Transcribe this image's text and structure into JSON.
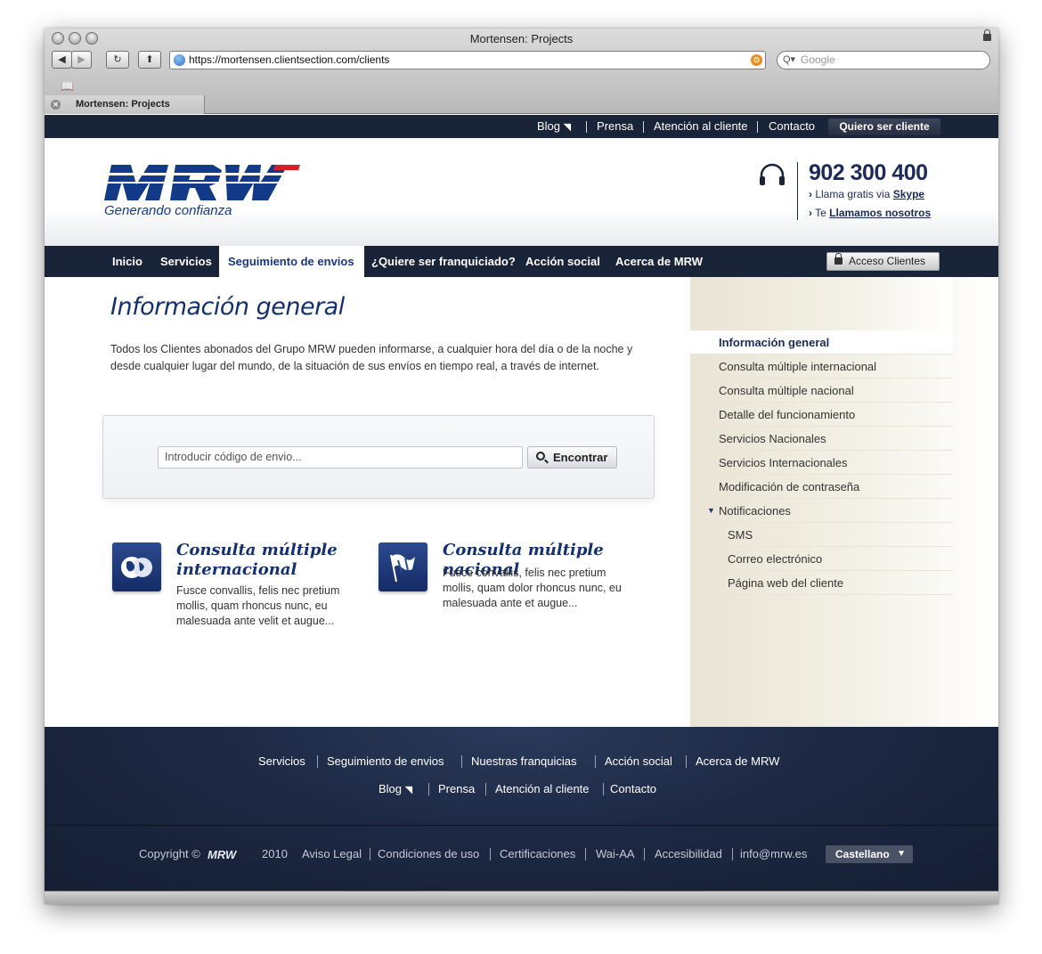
{
  "browser": {
    "window_title": "Mortensen: Projects",
    "url": "https://mortensen.clientsection.com/clients",
    "search_placeholder": "Google",
    "tab_label": "Mortensen: Projects"
  },
  "topbar": {
    "links": [
      "Blog",
      "Prensa",
      "Atención al cliente",
      "Contacto"
    ],
    "cta": "Quiero ser cliente"
  },
  "header": {
    "logo_text": "MRW",
    "tagline": "Generando confianza",
    "phone": "902 300 400",
    "skype_prefix": "Llama gratis via",
    "skype_link": "Skype",
    "call_prefix": "Te",
    "call_link": "Llamamos nosotros"
  },
  "nav": {
    "items": [
      "Inicio",
      "Servicios",
      "Seguimiento de envios",
      "¿Quiere ser franquiciado?",
      "Acción social",
      "Acerca de MRW"
    ],
    "active": "Seguimiento de envios",
    "access_button": "Acceso Clientes"
  },
  "main": {
    "title": "Información general",
    "intro": "Todos los Clientes abonados del Grupo MRW pueden informarse, a cualquier hora del día o de la noche y desde cualquier lugar del mundo, de la situación de sus envíos en tiempo real, a través de internet.",
    "search_placeholder": "Introducir código de envio...",
    "search_button": "Encontrar",
    "promos": [
      {
        "title": "Consulta múltiple internacional",
        "text": "Fusce convallis, felis nec pretium mollis, quam rhoncus nunc, eu malesuada ante velit et augue...",
        "icon": "globe-icon"
      },
      {
        "title": "Consulta múltiple nacional",
        "text": "Fusce convallis, felis nec pretium mollis, quam dolor rhoncus nunc, eu malesuada ante et augue...",
        "icon": "flag-icon"
      }
    ]
  },
  "sidebar": {
    "items": [
      "Información general",
      "Consulta múltiple internacional",
      "Consulta múltiple nacional",
      "Detalle del funcionamiento",
      "Servicios Nacionales",
      "Servicios Internacionales",
      "Modificación de contraseña",
      "Notificaciones"
    ],
    "subitems": [
      "SMS",
      "Correo electrónico",
      "Página web del cliente"
    ]
  },
  "footer": {
    "row1": [
      "Servicios",
      "Seguimiento de envios",
      "Nuestras franquicias",
      "Acción social",
      "Acerca de MRW"
    ],
    "row2": [
      "Blog",
      "Prensa",
      "Atención al cliente",
      "Contacto"
    ],
    "copyright": "Copyright ©",
    "year": "2010",
    "links": [
      "Aviso Legal",
      "Condiciones de uso",
      "Certificaciones",
      "Wai-AA",
      "Accesibilidad",
      "info@mrw.es"
    ],
    "language": "Castellano"
  },
  "colors": {
    "navy": "#1a2438",
    "brand_blue": "#13306f",
    "footer_dark": "#1d2944"
  }
}
